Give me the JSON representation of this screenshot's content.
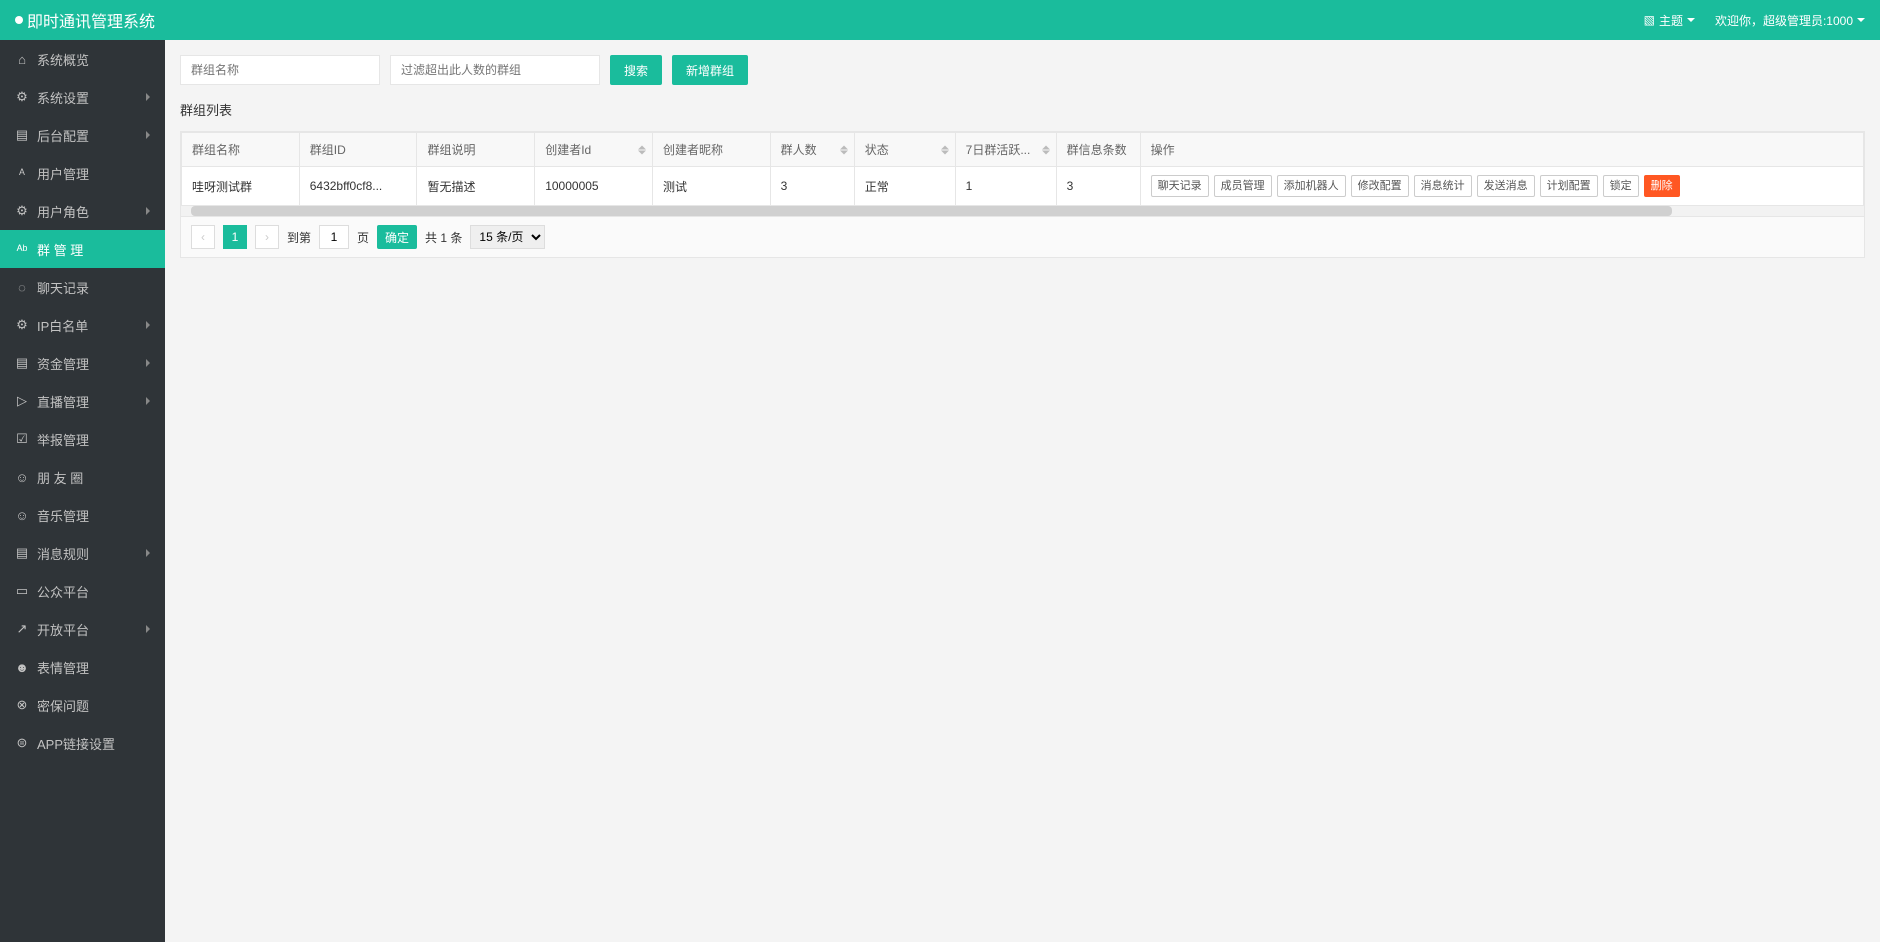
{
  "header": {
    "title": "即时通讯管理系统",
    "theme_label": "主题",
    "welcome": "欢迎你，超级管理员:1000"
  },
  "sidebar": {
    "items": [
      {
        "label": "系统概览",
        "icon": "home",
        "expandable": false,
        "active": false
      },
      {
        "label": "系统设置",
        "icon": "gear",
        "expandable": true,
        "active": false
      },
      {
        "label": "后台配置",
        "icon": "calendar",
        "expandable": true,
        "active": false
      },
      {
        "label": "用户管理",
        "icon": "user",
        "expandable": false,
        "active": false
      },
      {
        "label": "用户角色",
        "icon": "gear",
        "expandable": true,
        "active": false
      },
      {
        "label": "群 管 理",
        "icon": "users",
        "expandable": false,
        "active": true
      },
      {
        "label": "聊天记录",
        "icon": "chat",
        "expandable": false,
        "active": false
      },
      {
        "label": "IP白名单",
        "icon": "gear",
        "expandable": true,
        "active": false
      },
      {
        "label": "资金管理",
        "icon": "calendar",
        "expandable": true,
        "active": false
      },
      {
        "label": "直播管理",
        "icon": "play",
        "expandable": true,
        "active": false
      },
      {
        "label": "举报管理",
        "icon": "report",
        "expandable": false,
        "active": false
      },
      {
        "label": "朋 友 圈",
        "icon": "smile",
        "expandable": false,
        "active": false
      },
      {
        "label": "音乐管理",
        "icon": "smile",
        "expandable": false,
        "active": false
      },
      {
        "label": "消息规则",
        "icon": "calendar",
        "expandable": true,
        "active": false
      },
      {
        "label": "公众平台",
        "icon": "platform",
        "expandable": false,
        "active": false
      },
      {
        "label": "开放平台",
        "icon": "open",
        "expandable": true,
        "active": false
      },
      {
        "label": "表情管理",
        "icon": "emoji",
        "expandable": false,
        "active": false
      },
      {
        "label": "密保问题",
        "icon": "lock",
        "expandable": false,
        "active": false
      },
      {
        "label": "APP链接设置",
        "icon": "link",
        "expandable": false,
        "active": false
      }
    ]
  },
  "toolbar": {
    "name_placeholder": "群组名称",
    "filter_placeholder": "过滤超出此人数的群组",
    "search_label": "搜索",
    "add_label": "新增群组"
  },
  "panel": {
    "title": "群组列表"
  },
  "table": {
    "columns": [
      {
        "label": "群组名称",
        "sortable": false
      },
      {
        "label": "群组ID",
        "sortable": false
      },
      {
        "label": "群组说明",
        "sortable": false
      },
      {
        "label": "创建者Id",
        "sortable": true
      },
      {
        "label": "创建者昵称",
        "sortable": false
      },
      {
        "label": "群人数",
        "sortable": true
      },
      {
        "label": "状态",
        "sortable": true
      },
      {
        "label": "7日群活跃...",
        "sortable": true
      },
      {
        "label": "群信息条数",
        "sortable": false
      },
      {
        "label": "操作",
        "sortable": false
      }
    ],
    "rows": [
      {
        "name": "哇呀测试群",
        "id": "6432bff0cf8...",
        "desc": "暂无描述",
        "creator_id": "10000005",
        "creator_name": "测试",
        "members": "3",
        "status": "正常",
        "activity": "1",
        "messages": "3"
      }
    ],
    "actions": [
      {
        "label": "聊天记录",
        "danger": false
      },
      {
        "label": "成员管理",
        "danger": false
      },
      {
        "label": "添加机器人",
        "danger": false
      },
      {
        "label": "修改配置",
        "danger": false
      },
      {
        "label": "消息统计",
        "danger": false
      },
      {
        "label": "发送消息",
        "danger": false
      },
      {
        "label": "计划配置",
        "danger": false
      },
      {
        "label": "锁定",
        "danger": false
      },
      {
        "label": "删除",
        "danger": true
      }
    ]
  },
  "pagination": {
    "current": "1",
    "goto_label": "到第",
    "goto_value": "1",
    "page_unit": "页",
    "confirm": "确定",
    "total": "共 1 条",
    "pagesize": "15 条/页"
  }
}
